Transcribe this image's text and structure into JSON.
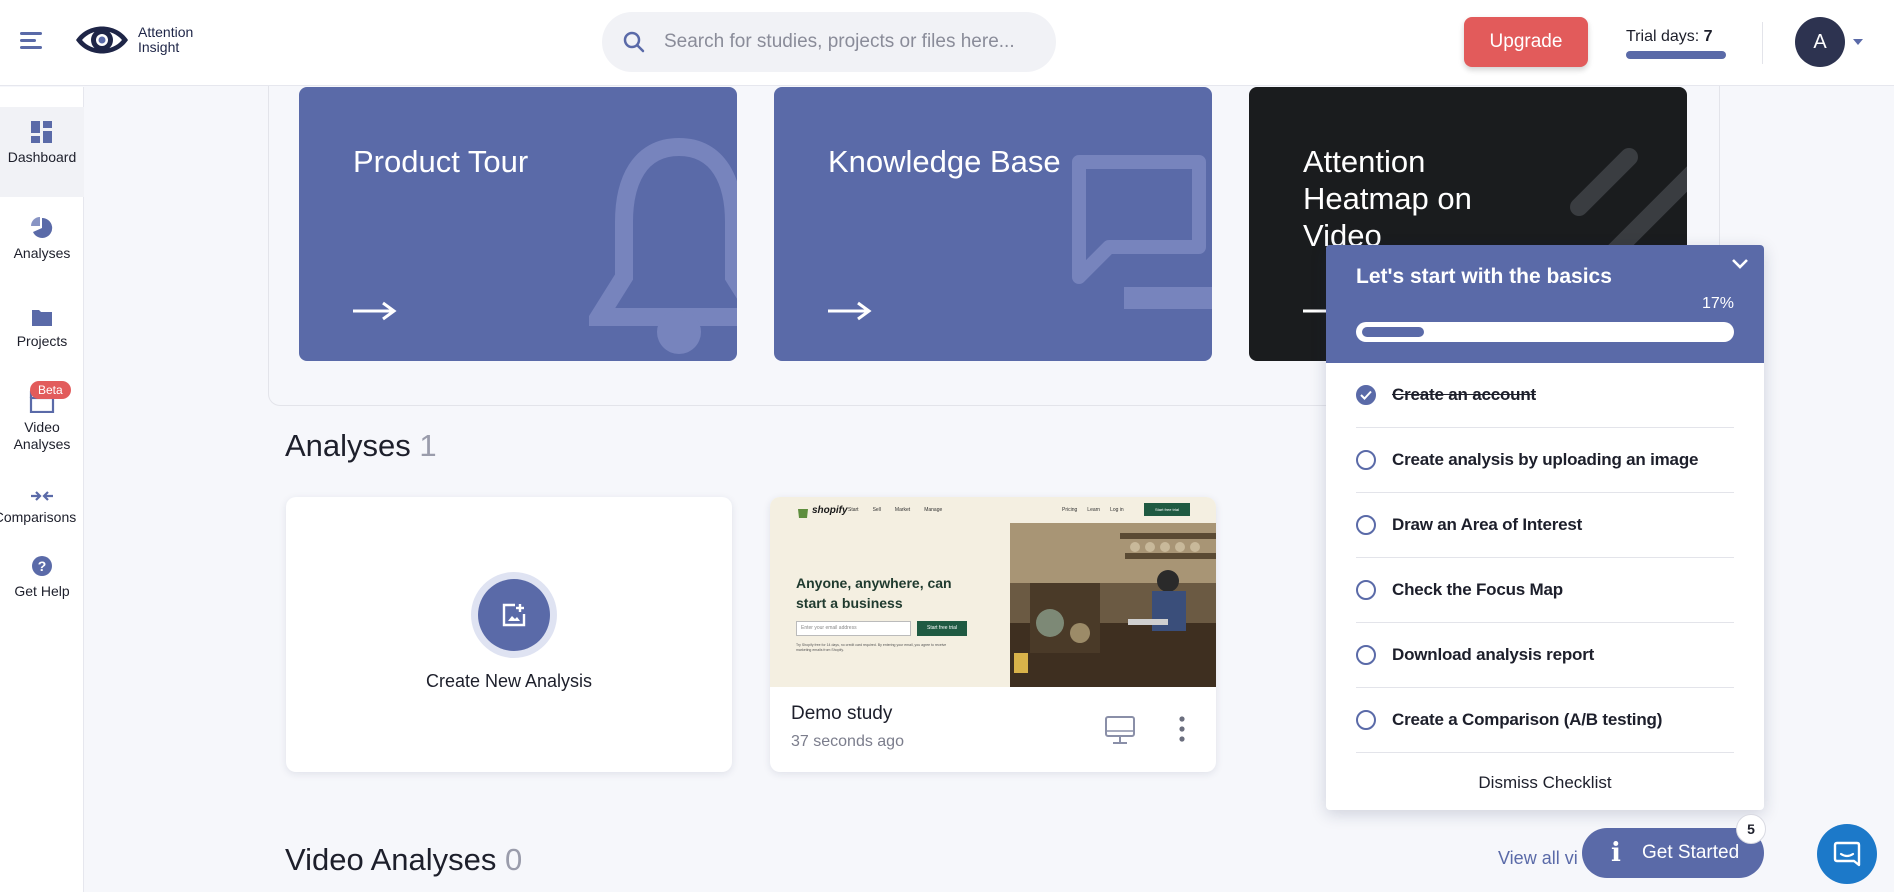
{
  "brand": {
    "line1": "Attention",
    "line2": "Insight",
    "accent": "#5a6aa8",
    "danger": "#e25b5b"
  },
  "search": {
    "placeholder": "Search for studies, projects or files here..."
  },
  "header": {
    "upgrade_label": "Upgrade",
    "trial_label": "Trial days:",
    "trial_days": "7",
    "avatar_initial": "A"
  },
  "sidebar": {
    "items": [
      {
        "label": "Dashboard",
        "icon": "dashboard-icon"
      },
      {
        "label": "Analyses",
        "icon": "pie-chart-icon"
      },
      {
        "label": "Projects",
        "icon": "folder-icon"
      },
      {
        "label": "Video Analyses",
        "icon": "clapperboard-icon",
        "badge": "Beta"
      },
      {
        "label": "Comparisons",
        "icon": "compare-arrows-icon"
      },
      {
        "label": "Get Help",
        "icon": "help-icon"
      }
    ]
  },
  "cards": [
    {
      "title": "Product Tour",
      "icon": "bell-icon"
    },
    {
      "title": "Knowledge Base",
      "icon": "chat-bubble-icon"
    },
    {
      "title": "Attention Heatmap on Video",
      "icon": "stripes-icon"
    }
  ],
  "analyses": {
    "title": "Analyses",
    "count": "1",
    "create_label": "Create New Analysis",
    "demo": {
      "title": "Demo study",
      "time": "37 seconds ago",
      "thumb": {
        "logo": "shopify",
        "nav": [
          "Start",
          "Sell",
          "Market",
          "Manage"
        ],
        "nav_right": [
          "Pricing",
          "Learn",
          "Log in"
        ],
        "cta": "Start free trial",
        "headline_1": "Anyone, anywhere, can",
        "headline_2": "start a business",
        "email_placeholder": "Enter your email address",
        "button": "Start free trial",
        "footnote_1": "Try Shopify free for 14 days, no credit card required. By entering your email, you agree to receive",
        "footnote_2": "marketing emails from Shopify."
      }
    }
  },
  "video_analyses": {
    "title": "Video Analyses",
    "count": "0",
    "view_all": "View all vi"
  },
  "checklist": {
    "title": "Let's start with the basics",
    "progress_label": "17%",
    "progress": 0.17,
    "items": [
      {
        "label": "Create an account",
        "done": true
      },
      {
        "label": "Create analysis by uploading an image",
        "done": false
      },
      {
        "label": "Draw an Area of Interest",
        "done": false
      },
      {
        "label": "Check the Focus Map",
        "done": false
      },
      {
        "label": "Download analysis report",
        "done": false
      },
      {
        "label": "Create a Comparison (A/B testing)",
        "done": false
      }
    ],
    "dismiss_label": "Dismiss Checklist"
  },
  "launcher": {
    "label": "Get Started",
    "badge": "5"
  }
}
